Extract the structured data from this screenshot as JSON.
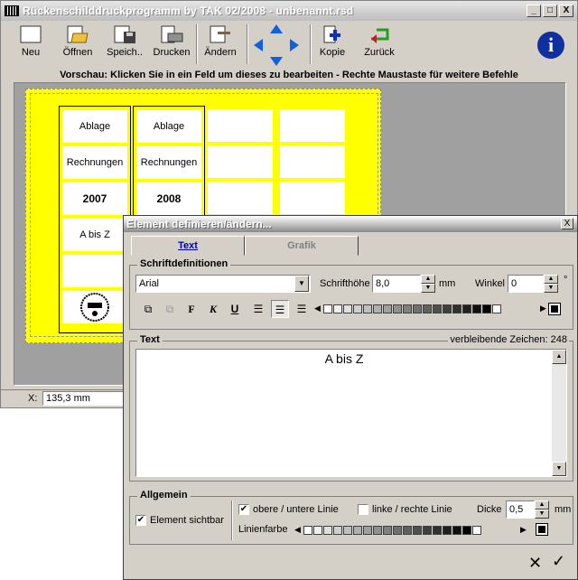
{
  "window": {
    "title": "Rückenschilddruckprogramm by TAK 02/2008 - unbenannt.rsd",
    "min": "_",
    "max": "□",
    "close": "X"
  },
  "toolbar": {
    "new": "Neu",
    "open": "Öffnen",
    "save": "Speich..",
    "print": "Drucken",
    "edit": "Ändern",
    "copy": "Kopie",
    "back": "Zurück"
  },
  "preview_label": "Vorschau: Klicken Sie in ein Feld um dieses zu bearbeiten - Rechte Maustaste für weitere Befehle",
  "labels": {
    "col1": [
      "Ablage",
      "Rechnungen",
      "2007",
      "A bis Z"
    ],
    "col2": [
      "Ablage",
      "Rechnungen",
      "2008"
    ]
  },
  "status": {
    "x_label": "X:",
    "x_value": "135,3 mm"
  },
  "dialog": {
    "title": "Element definieren/ändern...",
    "close": "X",
    "tabs": [
      "Text",
      "Grafik"
    ],
    "font_group": "Schriftdefinitionen",
    "font_name": "Arial",
    "font_height_label": "Schrifthöhe",
    "font_height": "8,0",
    "font_unit": "mm",
    "angle_label": "Winkel",
    "angle": "0",
    "angle_unit": "°",
    "bold": "F",
    "italic": "K",
    "underline": "U",
    "text_group": "Text",
    "remaining": "verbleibende Zeichen: 248",
    "text_value": "A bis Z",
    "general_group": "Allgemein",
    "visible_label": "Element sichtbar",
    "topbottom_label": "obere / untere Linie",
    "leftright_label": "linke / rechte Linie",
    "thickness_label": "Dicke",
    "thickness": "0,5",
    "thickness_unit": "mm",
    "linecolor_label": "Linienfarbe",
    "cancel": "✕",
    "ok": "✓"
  },
  "colors": {
    "sheet": "#ffff00",
    "swatches": [
      "#ffffff",
      "#f0f0f0",
      "#e0e0e0",
      "#d0d0d0",
      "#c0c0c0",
      "#b0b0b0",
      "#a0a0a0",
      "#909090",
      "#808080",
      "#707070",
      "#606060",
      "#505050",
      "#404040",
      "#303030",
      "#202020",
      "#101010",
      "#000000",
      "#ffffff"
    ]
  }
}
